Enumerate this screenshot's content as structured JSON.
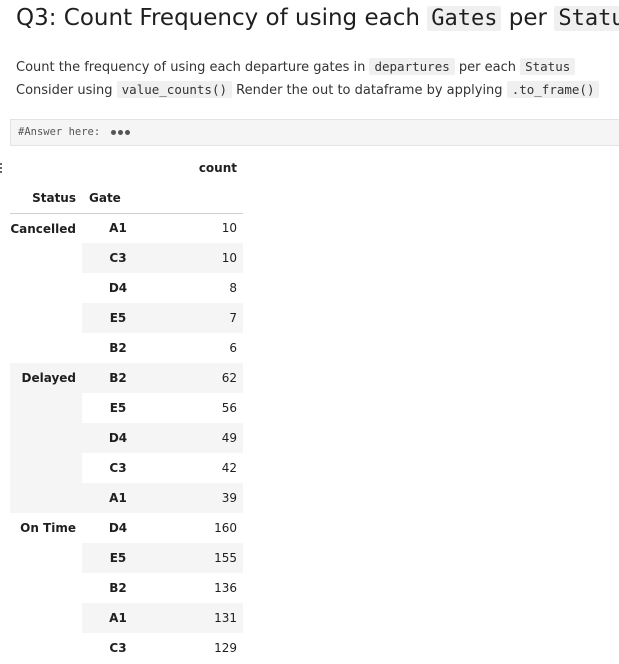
{
  "heading": {
    "prefix": "Q3: Count Frequency of using each",
    "code1": "Gates",
    "mid": "per",
    "code2": "Status"
  },
  "instructions": {
    "line1_prefix": "Count the frequency of using each departure gates in",
    "line1_code1": "departures",
    "line1_mid": "per each",
    "line1_code2": "Status",
    "line2_prefix": "Consider using",
    "line2_code1": "value_counts()",
    "line2_mid": "Render the out to dataframe by applying",
    "line2_code2": ".to_frame()"
  },
  "code_cell": {
    "text": "#Answer here:"
  },
  "table": {
    "column_header": "count",
    "index_names": [
      "Status",
      "Gate"
    ],
    "groups": [
      {
        "status": "Cancelled",
        "rows": [
          {
            "gate": "A1",
            "count": "10"
          },
          {
            "gate": "C3",
            "count": "10"
          },
          {
            "gate": "D4",
            "count": "8"
          },
          {
            "gate": "E5",
            "count": "7"
          },
          {
            "gate": "B2",
            "count": "6"
          }
        ]
      },
      {
        "status": "Delayed",
        "rows": [
          {
            "gate": "B2",
            "count": "62"
          },
          {
            "gate": "E5",
            "count": "56"
          },
          {
            "gate": "D4",
            "count": "49"
          },
          {
            "gate": "C3",
            "count": "42"
          },
          {
            "gate": "A1",
            "count": "39"
          }
        ]
      },
      {
        "status": "On Time",
        "rows": [
          {
            "gate": "D4",
            "count": "160"
          },
          {
            "gate": "E5",
            "count": "155"
          },
          {
            "gate": "B2",
            "count": "136"
          },
          {
            "gate": "A1",
            "count": "131"
          },
          {
            "gate": "C3",
            "count": "129"
          }
        ]
      }
    ]
  }
}
